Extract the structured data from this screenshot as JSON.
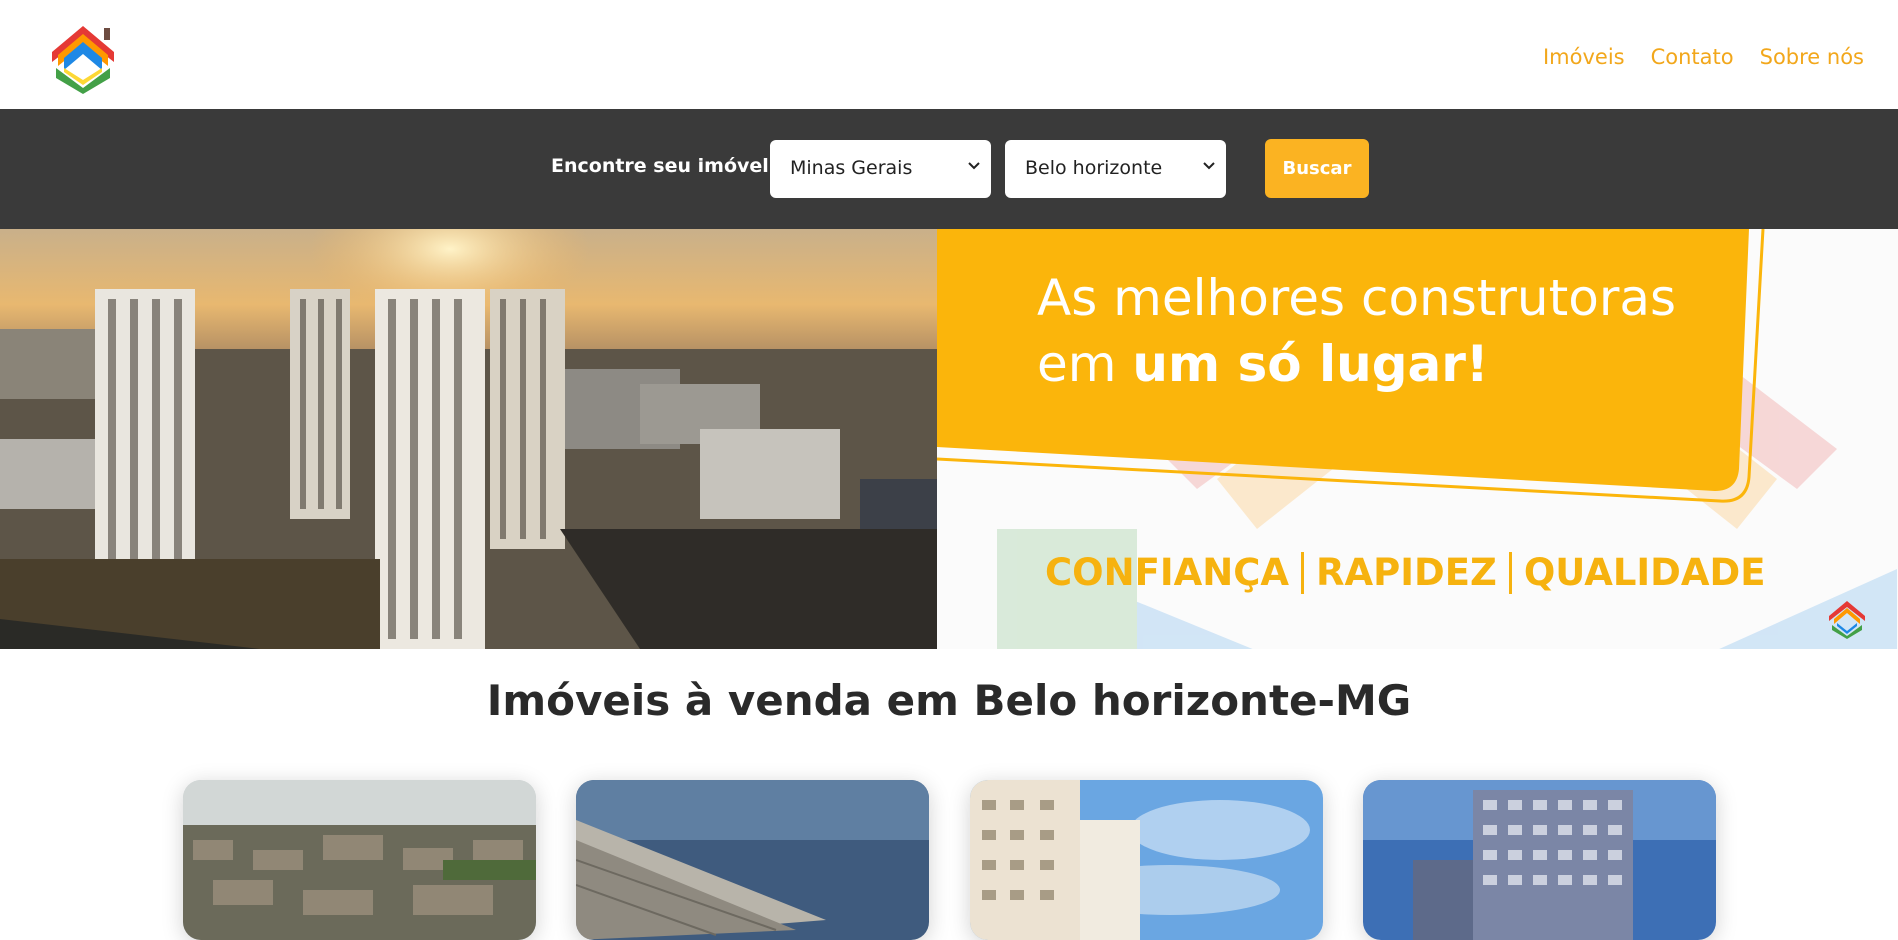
{
  "header": {
    "logo_icon": "house-logo-icon",
    "nav": [
      {
        "label": "Imóveis"
      },
      {
        "label": "Contato"
      },
      {
        "label": "Sobre nós"
      }
    ],
    "nav_color": "#f2a71b"
  },
  "search": {
    "label": "Encontre seu imóvel:",
    "state_value": "Minas Gerais",
    "city_value": "Belo horizonte",
    "button_label": "Buscar",
    "button_color": "#fbb322",
    "bar_color": "#3a3a3a"
  },
  "hero": {
    "title_line1": "As melhores construtoras",
    "title_line2_prefix": "em ",
    "title_line2_bold": "um só lugar!",
    "tags": [
      "CONFIANÇA",
      "RAPIDEZ",
      "QUALIDADE"
    ],
    "accent_color": "#fbb50b"
  },
  "listing": {
    "title": "Imóveis à venda em Belo horizonte-MG"
  }
}
